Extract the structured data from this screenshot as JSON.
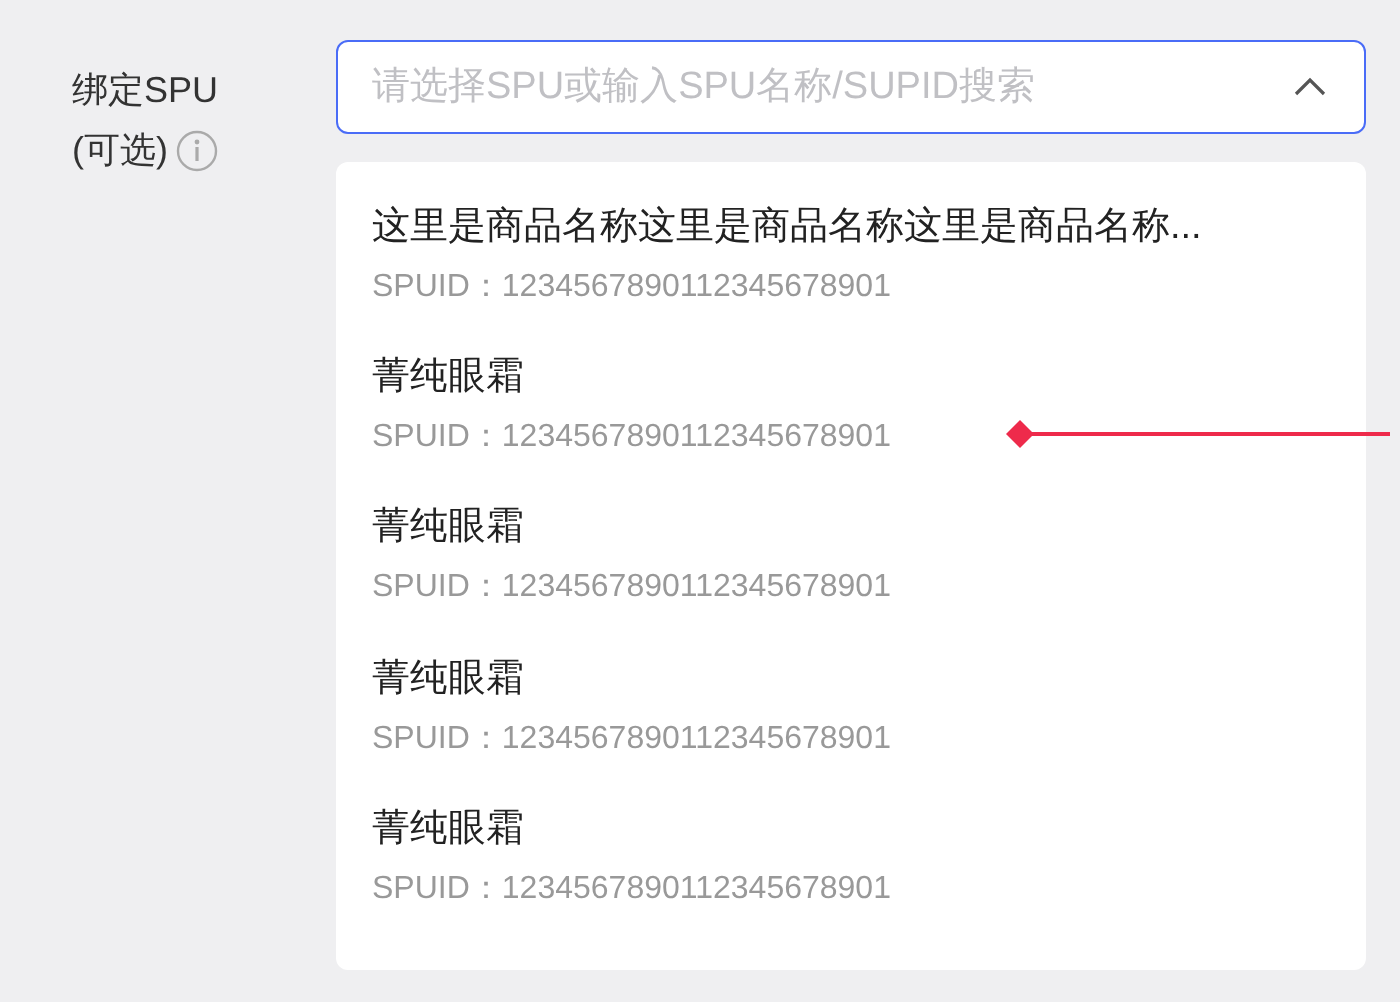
{
  "field": {
    "label": "绑定SPU",
    "optional_label": "(可选)",
    "placeholder": "请选择SPU或输入SPU名称/SUPID搜索",
    "expanded": true
  },
  "options": [
    {
      "name": "这里是商品名称这里是商品名称这里是商品名称...",
      "id": "SPUID：1234567890112345678901"
    },
    {
      "name": "菁纯眼霜",
      "id": "SPUID：1234567890112345678901"
    },
    {
      "name": "菁纯眼霜",
      "id": "SPUID：1234567890112345678901"
    },
    {
      "name": "菁纯眼霜",
      "id": "SPUID：1234567890112345678901"
    },
    {
      "name": "菁纯眼霜",
      "id": "SPUID：1234567890112345678901"
    }
  ]
}
